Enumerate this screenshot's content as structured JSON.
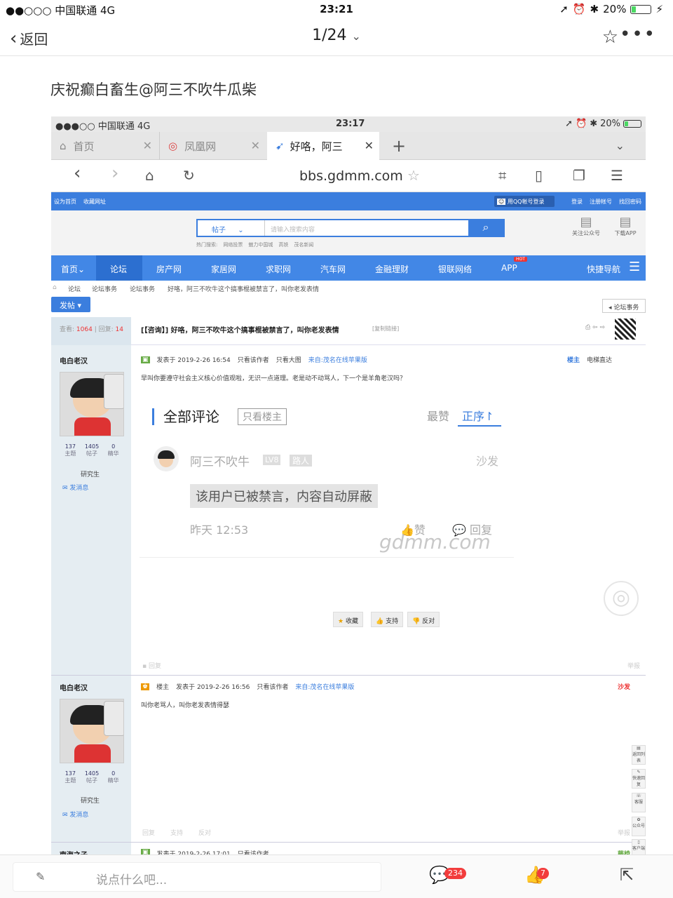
{
  "outer_status": {
    "carrier": "●●○○○ 中国联通  4G",
    "time": "23:21",
    "battery": "20%"
  },
  "outer_nav": {
    "back_label": "返回",
    "page_indicator": "1/24"
  },
  "post_title": "庆祝癫白畜生@阿三不吹牛瓜柴",
  "inner_status": {
    "carrier": "●●●○○ 中国联通  4G",
    "time": "23:17",
    "battery": "20%"
  },
  "browser_tabs": [
    {
      "label": "首页"
    },
    {
      "label": "凤凰网"
    },
    {
      "label": "好咯，阿三"
    }
  ],
  "browser_url": "bbs.gdmm.com",
  "site": {
    "topbar": {
      "set_home": "设为首页",
      "bookmark": "收藏网址",
      "qq_login": "用QQ帐号登录",
      "login": "登录",
      "register": "注册帐号",
      "find_pwd": "找回密码"
    },
    "search": {
      "category": "帖子",
      "placeholder": "请输入搜索内容",
      "hot_label": "热门搜索:",
      "hot_terms": [
        "网络投票",
        "魅力中国城",
        "高铁",
        "茂名新闻"
      ]
    },
    "qr": {
      "follow": "关注公众号",
      "download": "下载APP"
    },
    "nav": [
      "首页",
      "论坛",
      "房产网",
      "家居网",
      "求职网",
      "汽车网",
      "金融理财",
      "银联网络",
      "APP",
      "快捷导航"
    ],
    "nav_hot": "HOT",
    "breadcrumb": [
      "论坛",
      "论坛事务",
      "论坛事务",
      "好咯，阿三不吹牛这个搞事棍被禁言了，叫你老发表情"
    ],
    "post_button": "发帖",
    "back_button": "论坛事务",
    "views_label": "查看:",
    "views": "1064",
    "replies_label": "回复:",
    "replies": "14",
    "thread_title": "[【咨询】] 好咯，阿三不吹牛这个搞事棍被禁言了，叫你老发表情",
    "copy_link": "[复制链接]",
    "posts": [
      {
        "user": "电白老汉",
        "stats": [
          {
            "n": "137",
            "l": "主题"
          },
          {
            "n": "1405",
            "l": "帖子"
          },
          {
            "n": "0",
            "l": "精华"
          }
        ],
        "rank": "研究生",
        "message_btn": "发消息",
        "meta": "发表于 2019-2-26 16:54",
        "only_author": "只看该作者",
        "only_image": "只看大图",
        "from": "来自:茂名在线苹果版",
        "floor": "楼主",
        "elevator": "电梯直达",
        "content": "早叫你要遵守社会主义核心价值观啦，无识一点道理。老是动不动骂人，下一个是羊角老汉吗？",
        "actions": [
          "收藏",
          "支持",
          "反对"
        ],
        "reply": "回复",
        "report": "举报"
      },
      {
        "user": "电白老汉",
        "stats": [
          {
            "n": "137",
            "l": "主题"
          },
          {
            "n": "1405",
            "l": "帖子"
          },
          {
            "n": "0",
            "l": "精华"
          }
        ],
        "rank": "研究生",
        "message_btn": "发消息",
        "floor_owner": "楼主",
        "meta": "发表于 2019-2-26 16:56",
        "only_author": "只看该作者",
        "from": "来自:茂名在线苹果版",
        "floor": "沙发",
        "content": "叫你老骂人，叫你老发表情得瑟",
        "actions": [
          "回复",
          "支持",
          "反对"
        ],
        "report": "举报"
      },
      {
        "user": "南海之子",
        "meta": "发表于 2019-2-26 17:01",
        "only_author": "只看该作者",
        "floor": "藤椅"
      }
    ],
    "side_tools": [
      "返回列表",
      "快速回复",
      "客服",
      "公众号",
      "客户端"
    ]
  },
  "comment_card": {
    "title": "全部评论",
    "only_owner": "只看楼主",
    "sort_hot": "最赞",
    "sort_order": "正序",
    "user": "阿三不吹牛",
    "level": "LV8",
    "role": "路人",
    "floor": "沙发",
    "content": "该用户已被禁言，内容自动屏蔽",
    "time": "昨天 12:53",
    "like": "赞",
    "reply": "回复",
    "watermark": "gdmm.com"
  },
  "bottom_bar": {
    "input_placeholder": "说点什么吧...",
    "comment_count": "234",
    "like_count": "7"
  }
}
